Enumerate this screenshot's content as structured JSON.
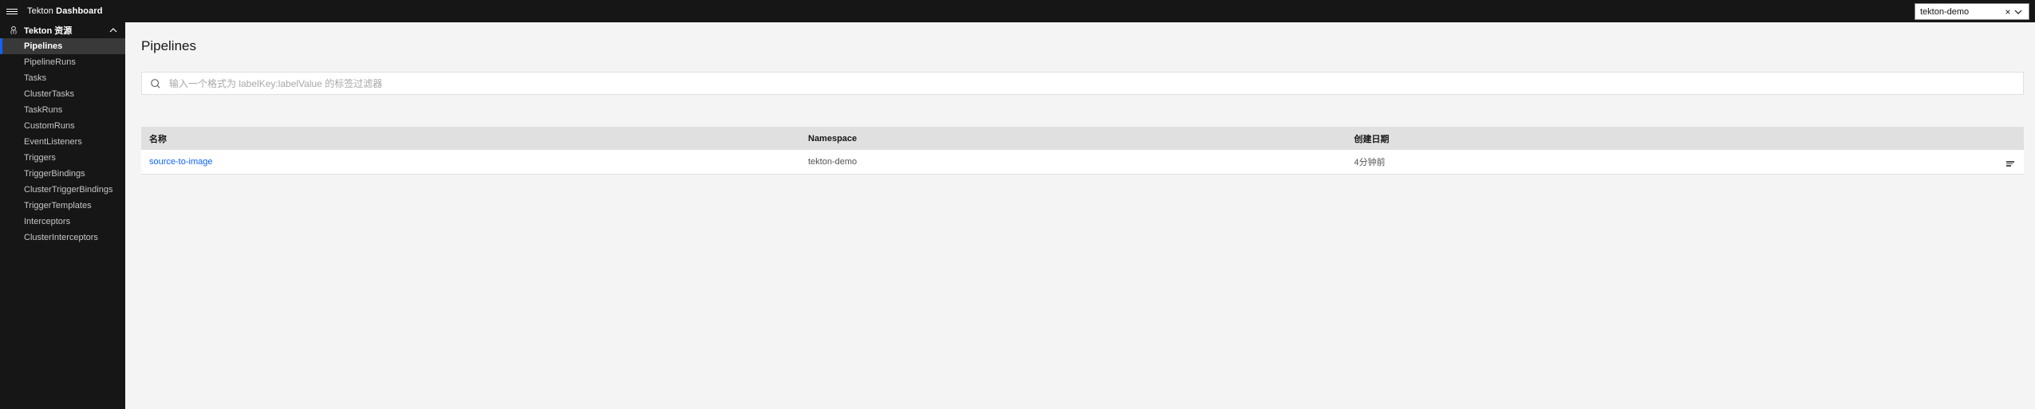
{
  "header": {
    "brand_prefix": "Tekton ",
    "brand_bold": "Dashboard",
    "namespace_value": "tekton-demo"
  },
  "sidebar": {
    "group_label": "Tekton 资源",
    "items": [
      "Pipelines",
      "PipelineRuns",
      "Tasks",
      "ClusterTasks",
      "TaskRuns",
      "CustomRuns",
      "EventListeners",
      "Triggers",
      "TriggerBindings",
      "ClusterTriggerBindings",
      "TriggerTemplates",
      "Interceptors",
      "ClusterInterceptors"
    ],
    "active": "Pipelines"
  },
  "main": {
    "title": "Pipelines",
    "filter_placeholder": "输入一个格式为 labelKey:labelValue 的标签过滤器",
    "columns": {
      "name": "名称",
      "namespace": "Namespace",
      "created": "创建日期"
    },
    "rows": [
      {
        "name": "source-to-image",
        "namespace": "tekton-demo",
        "created": "4分钟前"
      }
    ]
  }
}
